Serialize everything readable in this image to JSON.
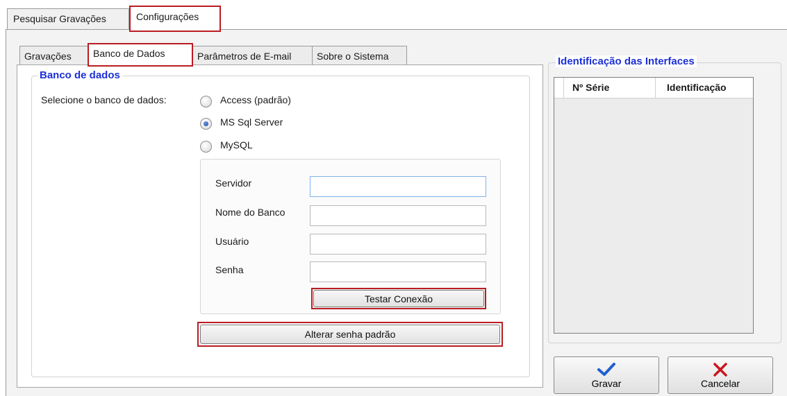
{
  "top_tabs": [
    {
      "label": "Pesquisar Gravações",
      "active": false
    },
    {
      "label": "Configurações",
      "active": true
    }
  ],
  "inner_tabs": [
    {
      "label": "Gravações",
      "active": false
    },
    {
      "label": "Banco de Dados",
      "active": true
    },
    {
      "label": "Parâmetros de E-mail",
      "active": false
    },
    {
      "label": "Sobre o Sistema",
      "active": false
    }
  ],
  "db_group": {
    "legend": "Banco de dados",
    "select_label": "Selecione o banco de dados:",
    "options": [
      {
        "label": "Access (padrão)",
        "checked": false
      },
      {
        "label": "MS Sql Server",
        "checked": true
      },
      {
        "label": "MySQL",
        "checked": false
      }
    ]
  },
  "connection": {
    "fields": [
      {
        "label": "Servidor",
        "value": ""
      },
      {
        "label": "Nome do Banco",
        "value": ""
      },
      {
        "label": "Usuário",
        "value": ""
      },
      {
        "label": "Senha",
        "value": ""
      }
    ],
    "test_button": "Testar Conexão"
  },
  "change_password_button": "Alterar senha padrão",
  "interfaces": {
    "legend": "Identificação das Interfaces",
    "columns": [
      "Nº Série",
      "Identificação"
    ],
    "rows": []
  },
  "actions": {
    "save": {
      "label": "Gravar",
      "icon": "check-icon",
      "color": "#1f5fd1"
    },
    "cancel": {
      "label": "Cancelar",
      "icon": "x-icon",
      "color": "#c8161d"
    }
  },
  "colors": {
    "highlight": "#b81c22",
    "legend_text": "#1b2fd6"
  }
}
